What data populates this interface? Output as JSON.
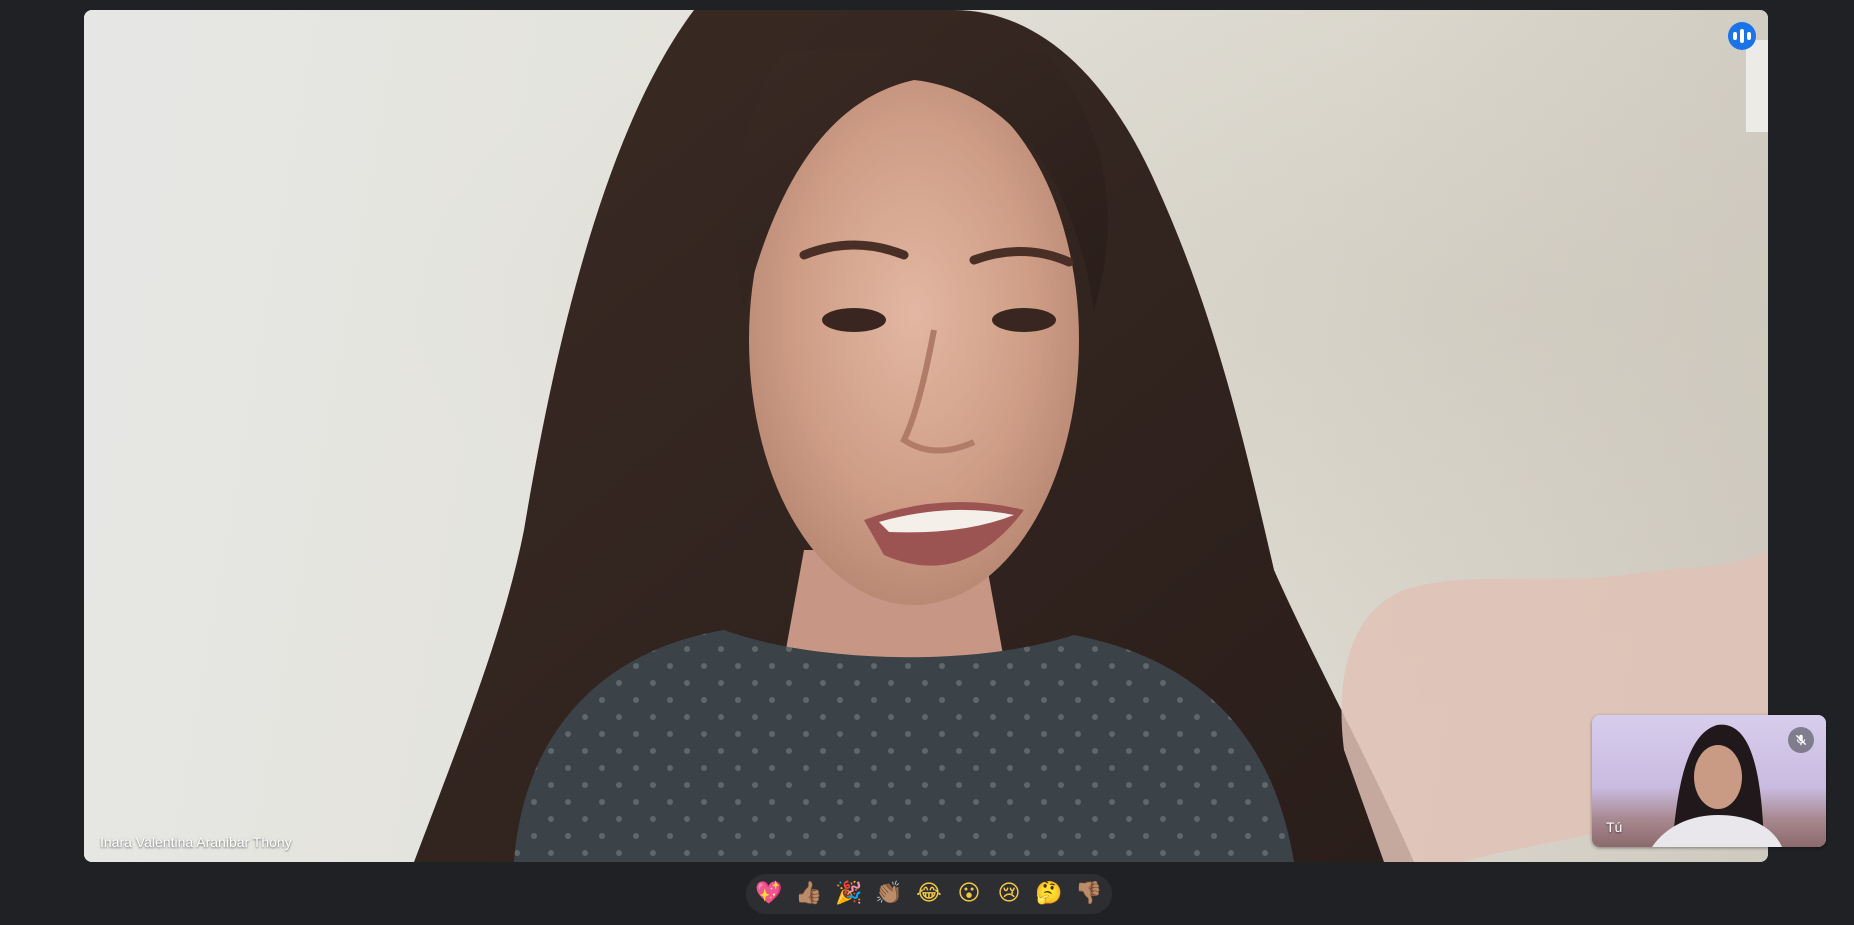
{
  "main_tile": {
    "participant_name": "Inara Valentina Aranibar Thony",
    "status_icon": "speaking-indicator-icon"
  },
  "self_view": {
    "label": "Tú",
    "status_icon": "mic-off-icon"
  },
  "reactions": [
    {
      "name": "sparkling-heart",
      "glyph": "💖"
    },
    {
      "name": "thumbs-up",
      "glyph": "👍🏽"
    },
    {
      "name": "party-popper",
      "glyph": "🎉"
    },
    {
      "name": "clapping-hands",
      "glyph": "👏🏽"
    },
    {
      "name": "tears-of-joy",
      "glyph": "😂"
    },
    {
      "name": "surprised",
      "glyph": "😮"
    },
    {
      "name": "sad",
      "glyph": "😢"
    },
    {
      "name": "thinking",
      "glyph": "🤔"
    },
    {
      "name": "thumbs-down",
      "glyph": "👎🏽"
    }
  ],
  "colors": {
    "background": "#202124",
    "accent": "#1a73e8",
    "reaction_bar": "#2d2e31"
  }
}
